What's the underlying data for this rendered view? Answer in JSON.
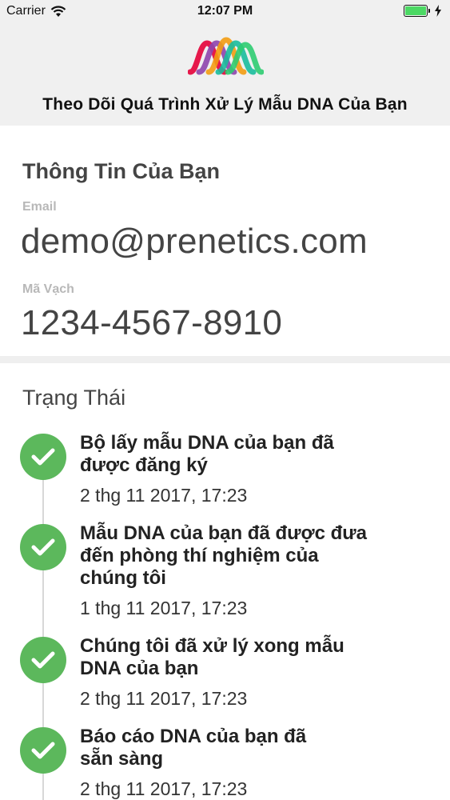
{
  "status_bar": {
    "carrier": "Carrier",
    "time": "12:07 PM"
  },
  "header": {
    "title": "Theo Dõi Quá Trình Xử Lý Mẫu DNA Của Bạn"
  },
  "info": {
    "title": "Thông Tin Của Bạn",
    "email_label": "Email",
    "email_value": "demo@prenetics.com",
    "barcode_label": "Mã Vạch",
    "barcode_value": "1234-4567-8910"
  },
  "status": {
    "title": "Trạng Thái",
    "steps": [
      {
        "line1": "Bộ lấy mẫu DNA của bạn đã",
        "line2": "được đăng ký",
        "line3": "",
        "date": "2 thg 11 2017, 17:23"
      },
      {
        "line1": "Mẫu DNA của bạn đã được đưa",
        "line2": "đến phòng thí nghiệm của",
        "line3": "chúng tôi",
        "date": "1 thg 11 2017, 17:23"
      },
      {
        "line1": "Chúng tôi đã xử lý xong mẫu",
        "line2": "DNA của bạn",
        "line3": "",
        "date": "2 thg 11 2017, 17:23"
      },
      {
        "line1": "Báo cáo DNA của bạn đã",
        "line2": "sẵn sàng",
        "line3": "",
        "date": "2 thg 11 2017, 17:23"
      }
    ]
  },
  "colors": {
    "check_green": "#5cb85c",
    "header_bg": "#f0f0f0",
    "battery_green": "#4cd964"
  }
}
